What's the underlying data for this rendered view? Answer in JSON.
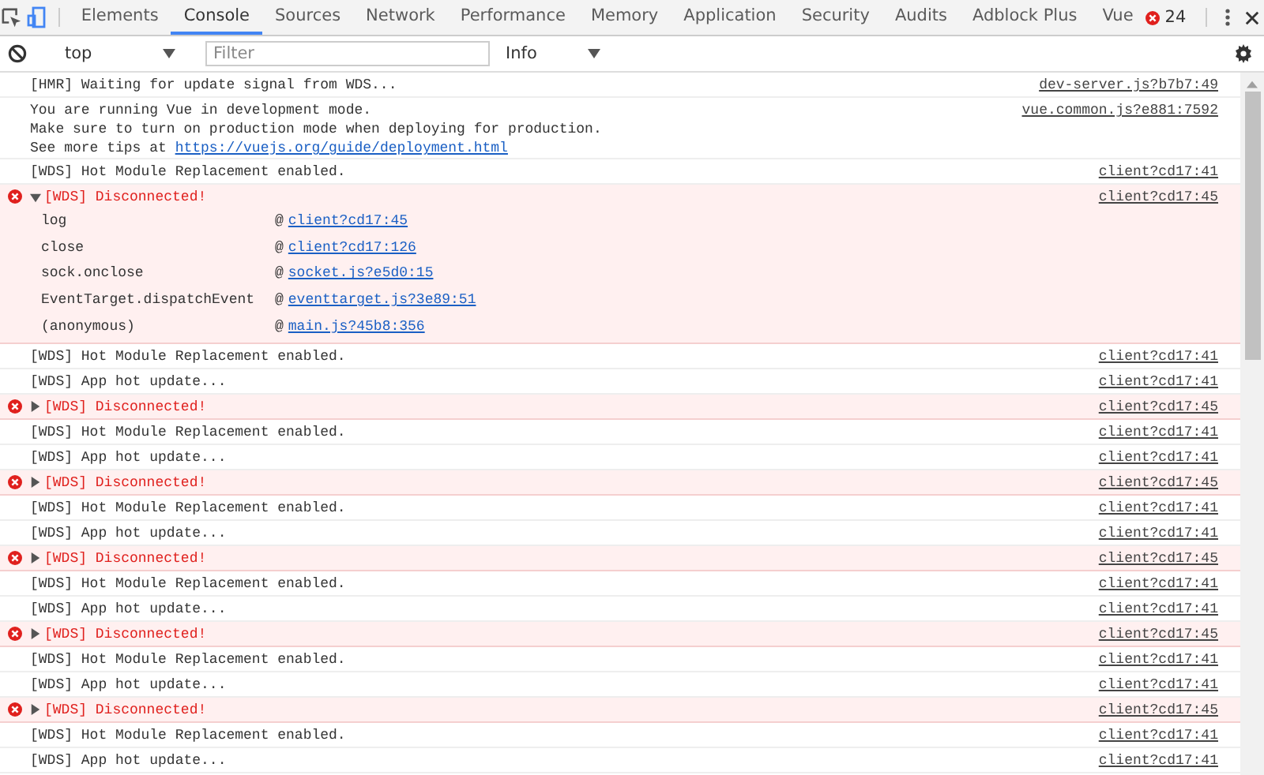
{
  "tabs": [
    {
      "label": "Elements",
      "selected": false
    },
    {
      "label": "Console",
      "selected": true
    },
    {
      "label": "Sources",
      "selected": false
    },
    {
      "label": "Network",
      "selected": false
    },
    {
      "label": "Performance",
      "selected": false
    },
    {
      "label": "Memory",
      "selected": false
    },
    {
      "label": "Application",
      "selected": false
    },
    {
      "label": "Security",
      "selected": false
    },
    {
      "label": "Audits",
      "selected": false
    },
    {
      "label": "Adblock Plus",
      "selected": false
    },
    {
      "label": "Vue",
      "selected": false
    }
  ],
  "error_count": "24",
  "toolbar": {
    "context": "top",
    "filter": {
      "placeholder": "Filter"
    },
    "level": "Info"
  },
  "messages": [
    {
      "kind": "log",
      "lines": [
        {
          "text": "[HMR] Waiting for update signal from WDS..."
        }
      ],
      "source": "dev-server.js?b7b7:49"
    },
    {
      "kind": "log",
      "lines": [
        {
          "text": "You are running Vue in development mode."
        },
        {
          "text": "Make sure to turn on production mode when deploying for production."
        },
        {
          "text": "See more tips at ",
          "link": "https://vuejs.org/guide/deployment.html"
        }
      ],
      "source": "vue.common.js?e881:7592"
    },
    {
      "kind": "log",
      "lines": [
        {
          "text": "[WDS] Hot Module Replacement enabled."
        }
      ],
      "source": "client?cd17:41"
    },
    {
      "kind": "error",
      "expanded": true,
      "lines": [
        {
          "text": "[WDS] Disconnected!"
        }
      ],
      "source": "client?cd17:45",
      "stack": [
        {
          "function": "log",
          "at": "@",
          "location": "client?cd17:45"
        },
        {
          "function": "close",
          "at": "@",
          "location": "client?cd17:126"
        },
        {
          "function": "sock.onclose",
          "at": "@",
          "location": "socket.js?e5d0:15"
        },
        {
          "function": "EventTarget.dispatchEvent",
          "at": "@",
          "location": "eventtarget.js?3e89:51"
        },
        {
          "function": "(anonymous)",
          "at": "@",
          "location": "main.js?45b8:356"
        }
      ]
    },
    {
      "kind": "log",
      "lines": [
        {
          "text": "[WDS] Hot Module Replacement enabled."
        }
      ],
      "source": "client?cd17:41"
    },
    {
      "kind": "log",
      "lines": [
        {
          "text": "[WDS] App hot update..."
        }
      ],
      "source": "client?cd17:41"
    },
    {
      "kind": "error",
      "expanded": false,
      "lines": [
        {
          "text": "[WDS] Disconnected!"
        }
      ],
      "source": "client?cd17:45"
    },
    {
      "kind": "log",
      "lines": [
        {
          "text": "[WDS] Hot Module Replacement enabled."
        }
      ],
      "source": "client?cd17:41"
    },
    {
      "kind": "log",
      "lines": [
        {
          "text": "[WDS] App hot update..."
        }
      ],
      "source": "client?cd17:41"
    },
    {
      "kind": "error",
      "expanded": false,
      "lines": [
        {
          "text": "[WDS] Disconnected!"
        }
      ],
      "source": "client?cd17:45"
    },
    {
      "kind": "log",
      "lines": [
        {
          "text": "[WDS] Hot Module Replacement enabled."
        }
      ],
      "source": "client?cd17:41"
    },
    {
      "kind": "log",
      "lines": [
        {
          "text": "[WDS] App hot update..."
        }
      ],
      "source": "client?cd17:41"
    },
    {
      "kind": "error",
      "expanded": false,
      "lines": [
        {
          "text": "[WDS] Disconnected!"
        }
      ],
      "source": "client?cd17:45"
    },
    {
      "kind": "log",
      "lines": [
        {
          "text": "[WDS] Hot Module Replacement enabled."
        }
      ],
      "source": "client?cd17:41"
    },
    {
      "kind": "log",
      "lines": [
        {
          "text": "[WDS] App hot update..."
        }
      ],
      "source": "client?cd17:41"
    },
    {
      "kind": "error",
      "expanded": false,
      "lines": [
        {
          "text": "[WDS] Disconnected!"
        }
      ],
      "source": "client?cd17:45"
    },
    {
      "kind": "log",
      "lines": [
        {
          "text": "[WDS] Hot Module Replacement enabled."
        }
      ],
      "source": "client?cd17:41"
    },
    {
      "kind": "log",
      "lines": [
        {
          "text": "[WDS] App hot update..."
        }
      ],
      "source": "client?cd17:41"
    },
    {
      "kind": "error",
      "expanded": false,
      "lines": [
        {
          "text": "[WDS] Disconnected!"
        }
      ],
      "source": "client?cd17:45"
    },
    {
      "kind": "log",
      "lines": [
        {
          "text": "[WDS] Hot Module Replacement enabled."
        }
      ],
      "source": "client?cd17:41"
    },
    {
      "kind": "log",
      "lines": [
        {
          "text": "[WDS] App hot update..."
        }
      ],
      "source": "client?cd17:41"
    }
  ]
}
